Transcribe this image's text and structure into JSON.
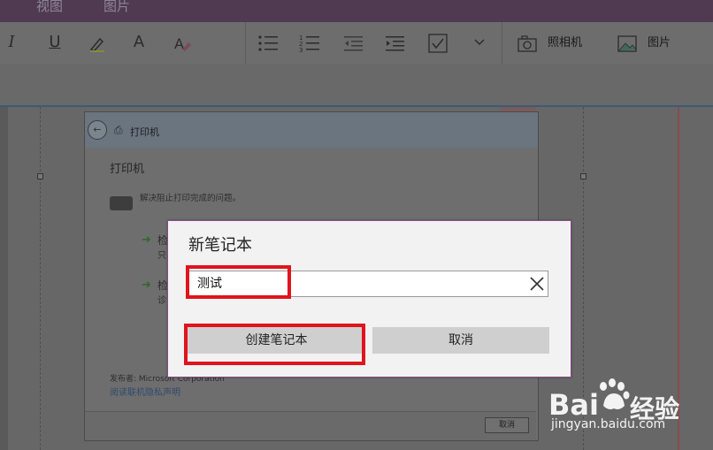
{
  "menu": {
    "view": "视图",
    "picture": "图片"
  },
  "ribbon": {
    "camera_label": "照相机",
    "picture_label": "图片"
  },
  "background_window": {
    "title": "打印机",
    "heading": "打印机",
    "description": "解决阻止打印完成的问题。",
    "option1_line1": "检",
    "option1_line2": "只",
    "option2_line1": "检",
    "option2_line2": "诊",
    "publisher": "发布者: Microsoft Corporation",
    "privacy_link": "阅读联机隐私声明",
    "cancel_label": "取消"
  },
  "dialog": {
    "title": "新笔记本",
    "input_value": "测试",
    "create_label": "创建笔记本",
    "cancel_label": "取消"
  },
  "watermark": {
    "brand_left": "Bai",
    "brand_right": "经验",
    "url": "jingyan.baidu.com"
  },
  "colors": {
    "highlight": "#e0141c",
    "dialog_border": "#8a4a8a"
  },
  "icons": [
    "italic-icon",
    "underline-icon",
    "highlight-icon",
    "font-color-icon",
    "clear-format-icon",
    "bullet-list-icon",
    "numbered-list-icon",
    "decrease-indent-icon",
    "increase-indent-icon",
    "checkbox-icon",
    "chevron-down-icon",
    "camera-icon",
    "picture-icon",
    "close-icon"
  ]
}
